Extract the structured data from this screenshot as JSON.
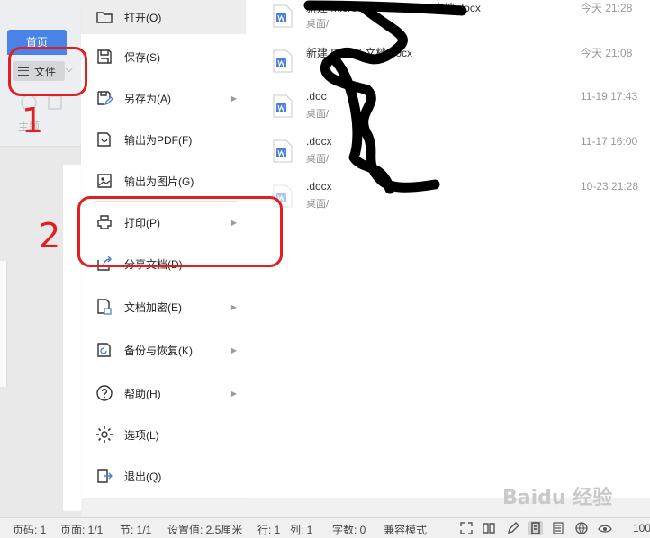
{
  "editor": {
    "home_tab": "首页",
    "file_button": "文件",
    "style_label": "主题"
  },
  "menu": {
    "items": [
      {
        "label": "打开(O)",
        "icon": "folder-icon",
        "submenu": false
      },
      {
        "label": "保存(S)",
        "icon": "save-icon",
        "submenu": false
      },
      {
        "label": "另存为(A)",
        "icon": "save-as-icon",
        "submenu": true
      },
      {
        "label": "输出为PDF(F)",
        "icon": "pdf-export-icon",
        "submenu": false
      },
      {
        "label": "输出为图片(G)",
        "icon": "image-export-icon",
        "submenu": false
      },
      {
        "label": "打印(P)",
        "icon": "printer-icon",
        "submenu": true
      },
      {
        "label": "分享文档(D)",
        "icon": "share-icon",
        "submenu": false
      },
      {
        "label": "文档加密(E)",
        "icon": "lock-document-icon",
        "submenu": true
      },
      {
        "label": "备份与恢复(K)",
        "icon": "backup-icon",
        "submenu": true
      },
      {
        "label": "帮助(H)",
        "icon": "help-icon",
        "submenu": true
      },
      {
        "label": "选项(L)",
        "icon": "gear-icon",
        "submenu": false
      },
      {
        "label": "退出(Q)",
        "icon": "exit-icon",
        "submenu": false
      }
    ]
  },
  "recent_files": [
    {
      "name": "新建 Microsoft Word 2007 文档.docx",
      "path": "桌面/",
      "time": "今天 21:28"
    },
    {
      "name": "新建 DOCX 文档.docx",
      "path": "",
      "time": "今天 21:08"
    },
    {
      "name": ".doc",
      "path": "桌面/",
      "time": "11-19 17:43"
    },
    {
      "name": ".docx",
      "path": "桌面/",
      "time": "11-17 16:00"
    },
    {
      "name": ".docx",
      "path": "桌面/",
      "time": "10-23 21:28"
    }
  ],
  "status_bar": {
    "page_num": "页码: 1",
    "page_count": "页面: 1/1",
    "section": "节: 1/1",
    "setting": "设置值: 2.5厘米",
    "row": "行: 1",
    "column": "列: 1",
    "word_count": "字数: 0",
    "compat_mode": "兼容模式",
    "zoom": "100"
  },
  "annotations": {
    "step1": "1",
    "step2": "2"
  },
  "watermark": "Baidu 经验",
  "colors": {
    "accent": "#4a83e8",
    "annotation_red": "#e02020",
    "word_icon_blue": "#4a7fd8"
  }
}
